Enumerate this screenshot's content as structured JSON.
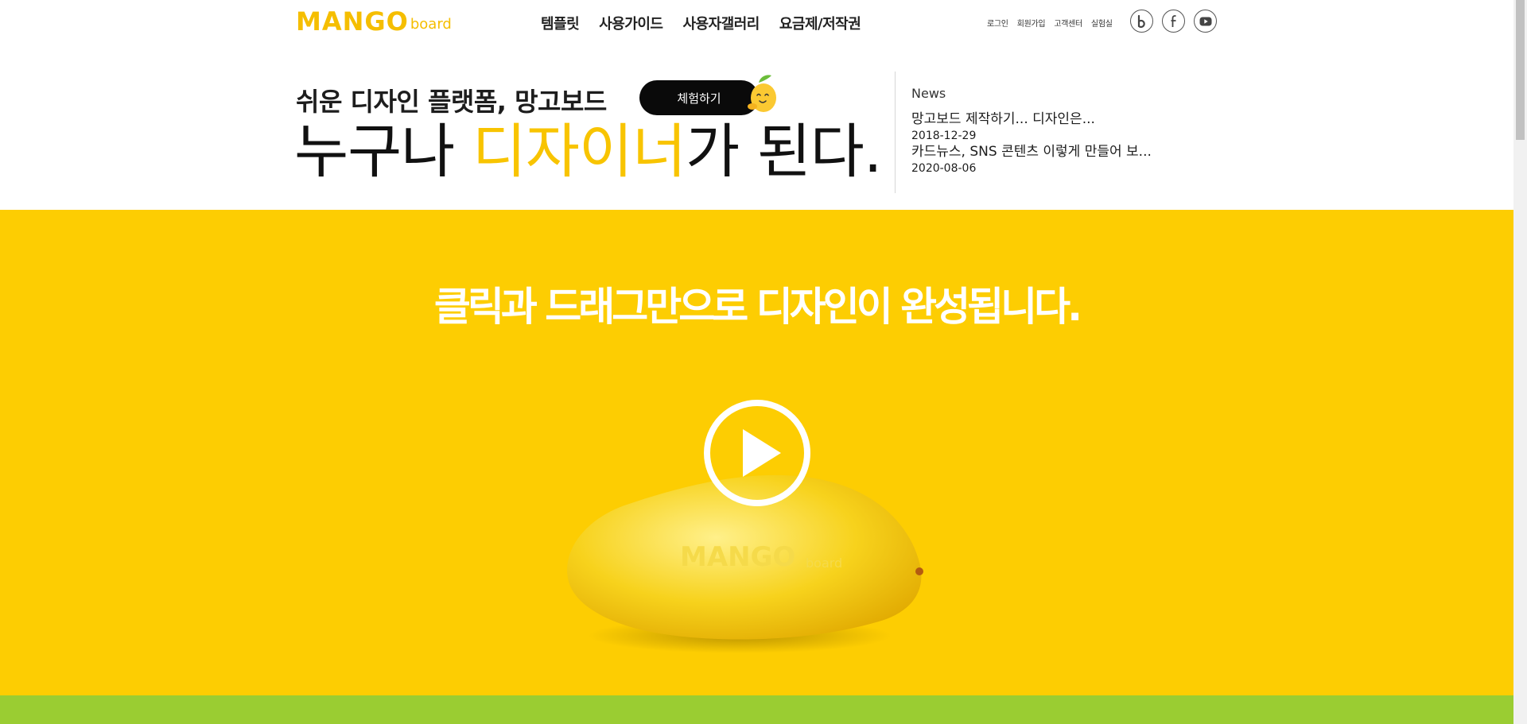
{
  "header": {
    "logo_main": "MANGO",
    "logo_sub": "board",
    "nav": [
      "템플릿",
      "사용가이드",
      "사용자갤러리",
      "요금제/저작권"
    ],
    "util_links": [
      "로그인",
      "회원가입",
      "고객센터",
      "실험실"
    ],
    "social_icons": [
      "blog-icon",
      "facebook-icon",
      "youtube-icon"
    ]
  },
  "intro": {
    "line1": "쉬운 디자인 플랫폼, 망고보드",
    "try_button": "체험하기",
    "line2_pre": "누구나 ",
    "line2_highlight": "디자이너",
    "line2_post": "가 된다."
  },
  "news": {
    "title": "News",
    "items": [
      {
        "title": "망고보드 제작하기... 디자인은...",
        "date": "2018-12-29"
      },
      {
        "title": "카드뉴스, SNS 콘텐츠 이렇게 만들어 보...",
        "date": "2020-08-06"
      }
    ]
  },
  "hero": {
    "title": "클릭과 드래그만으로 디자인이 완성됩니다.",
    "mango_logo_main": "MANGO",
    "mango_logo_sub": "board"
  },
  "colors": {
    "brand_yellow": "#fdcd02",
    "highlight": "#f8c400",
    "green": "#9acd32"
  }
}
